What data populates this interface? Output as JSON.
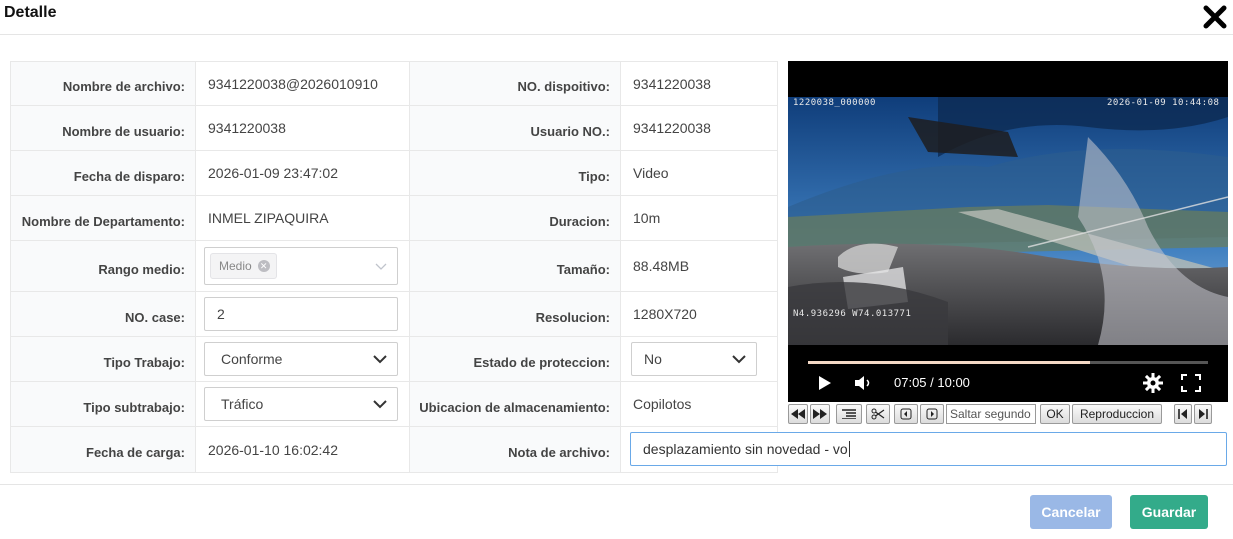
{
  "dialog": {
    "title": "Detalle"
  },
  "fields": {
    "file_name": {
      "label": "Nombre de archivo:",
      "value": "9341220038@2026010910"
    },
    "device_no": {
      "label": "NO. dispoitivo:",
      "value": "9341220038"
    },
    "user_name": {
      "label": "Nombre de usuario:",
      "value": "9341220038"
    },
    "user_no": {
      "label": "Usuario NO.:",
      "value": "9341220038"
    },
    "trigger_date": {
      "label": "Fecha de disparo:",
      "value": "2026-01-09 23:47:02"
    },
    "type": {
      "label": "Tipo:",
      "value": "Video"
    },
    "department": {
      "label": "Nombre de Departamento:",
      "value": "INMEL ZIPAQUIRA"
    },
    "duration": {
      "label": "Duracion:",
      "value": "10m"
    },
    "medium_range": {
      "label": "Rango medio:",
      "tag": "Medio"
    },
    "size": {
      "label": "Tamaño:",
      "value": "88.48MB"
    },
    "case_no": {
      "label": "NO. case:",
      "value": "2"
    },
    "resolution": {
      "label": "Resolucion:",
      "value": "1280X720"
    },
    "work_type": {
      "label": "Tipo Trabajo:",
      "value": "Conforme"
    },
    "protection_state": {
      "label": "Estado de proteccion:",
      "value": "No"
    },
    "work_subtype": {
      "label": "Tipo subtrabajo:",
      "value": "Tráfico"
    },
    "storage_location": {
      "label": "Ubicacion de almacenamiento:",
      "value": "Copilotos"
    },
    "upload_date": {
      "label": "Fecha de carga:",
      "value": "2026-01-10 16:02:42"
    },
    "file_note": {
      "label": "Nota de archivo:",
      "value": "desplazamiento sin novedad - vo"
    }
  },
  "video": {
    "osd_left": "1220038_000000",
    "osd_right": "2026-01-09 10:44:08",
    "osd_coords": "N4.936296 W74.013771",
    "time": "07:05 / 10:00",
    "progress": 0.705
  },
  "toolbar": {
    "seek_placeholder": "Saltar segundo",
    "ok_label": "OK",
    "playback_label": "Reproduccion"
  },
  "buttons": {
    "cancel": "Cancelar",
    "save": "Guardar"
  },
  "colors": {
    "save": "#33ab8a",
    "cancel": "#9ab8e6",
    "focus_border": "#6aa9e8"
  }
}
